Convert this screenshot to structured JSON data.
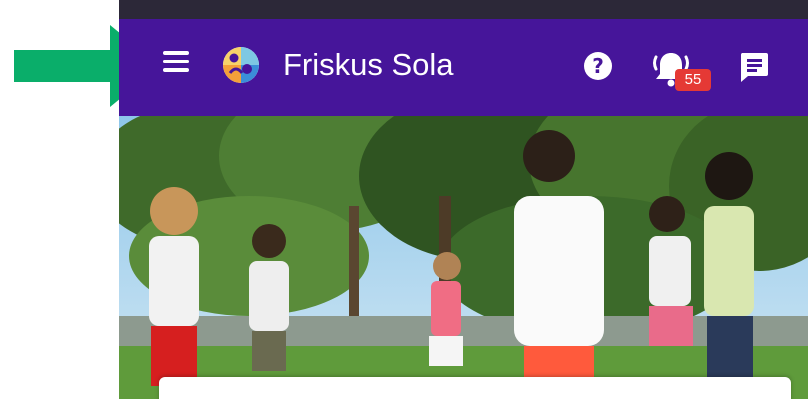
{
  "header": {
    "app_title": "Friskus Sola",
    "notification_count": "55",
    "background_color": "#46159a",
    "status_bar_color": "#2c2838"
  },
  "icons": {
    "menu": "hamburger-menu-icon",
    "logo": "friskus-logo",
    "help": "help-icon",
    "help_glyph": "?",
    "notifications": "bell-ringing-icon",
    "messages": "chat-message-icon"
  },
  "annotation": {
    "arrow_color": "#0aae6a"
  }
}
